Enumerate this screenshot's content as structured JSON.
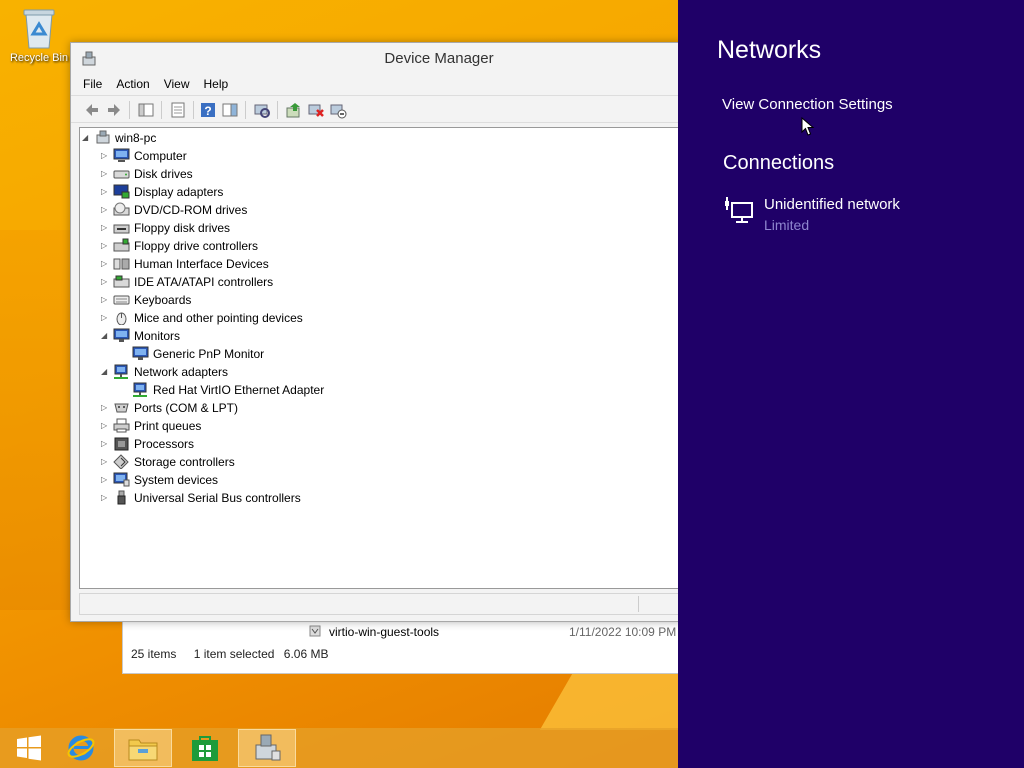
{
  "desktop": {
    "recycle_bin_label": "Recycle Bin"
  },
  "explorer": {
    "file_name": "virtio-win-guest-tools",
    "file_date": "1/11/2022 10:09 PM",
    "items_count": "25 items",
    "selected": "1 item selected",
    "size": "6.06 MB"
  },
  "device_manager": {
    "title": "Device Manager",
    "menu": [
      "File",
      "Action",
      "View",
      "Help"
    ],
    "root": "win8-pc",
    "tree": [
      {
        "label": "Computer",
        "level": 1,
        "expanded": false,
        "icon": "computer-icon"
      },
      {
        "label": "Disk drives",
        "level": 1,
        "expanded": false,
        "icon": "disk-drive-icon"
      },
      {
        "label": "Display adapters",
        "level": 1,
        "expanded": false,
        "icon": "display-adapter-icon"
      },
      {
        "label": "DVD/CD-ROM drives",
        "level": 1,
        "expanded": false,
        "icon": "dvd-drive-icon"
      },
      {
        "label": "Floppy disk drives",
        "level": 1,
        "expanded": false,
        "icon": "floppy-drive-icon"
      },
      {
        "label": "Floppy drive controllers",
        "level": 1,
        "expanded": false,
        "icon": "floppy-controller-icon"
      },
      {
        "label": "Human Interface Devices",
        "level": 1,
        "expanded": false,
        "icon": "hid-icon"
      },
      {
        "label": "IDE ATA/ATAPI controllers",
        "level": 1,
        "expanded": false,
        "icon": "ide-controller-icon"
      },
      {
        "label": "Keyboards",
        "level": 1,
        "expanded": false,
        "icon": "keyboard-icon"
      },
      {
        "label": "Mice and other pointing devices",
        "level": 1,
        "expanded": false,
        "icon": "mouse-icon"
      },
      {
        "label": "Monitors",
        "level": 1,
        "expanded": true,
        "icon": "monitor-icon"
      },
      {
        "label": "Generic PnP Monitor",
        "level": 2,
        "icon": "monitor-icon"
      },
      {
        "label": "Network adapters",
        "level": 1,
        "expanded": true,
        "icon": "network-adapter-icon"
      },
      {
        "label": "Red Hat VirtIO Ethernet Adapter",
        "level": 2,
        "icon": "network-adapter-icon"
      },
      {
        "label": "Ports (COM & LPT)",
        "level": 1,
        "expanded": false,
        "icon": "port-icon"
      },
      {
        "label": "Print queues",
        "level": 1,
        "expanded": false,
        "icon": "printer-icon"
      },
      {
        "label": "Processors",
        "level": 1,
        "expanded": false,
        "icon": "processor-icon"
      },
      {
        "label": "Storage controllers",
        "level": 1,
        "expanded": false,
        "icon": "storage-controller-icon"
      },
      {
        "label": "System devices",
        "level": 1,
        "expanded": false,
        "icon": "system-device-icon"
      },
      {
        "label": "Universal Serial Bus controllers",
        "level": 1,
        "expanded": false,
        "icon": "usb-icon"
      }
    ]
  },
  "networks": {
    "title": "Networks",
    "view_settings": "View Connection Settings",
    "connections_header": "Connections",
    "connection_name": "Unidentified network",
    "connection_status": "Limited",
    "background_color": "#1f0068"
  },
  "taskbar": {
    "items": [
      "start-icon",
      "internet-explorer-icon",
      "file-explorer-icon",
      "store-icon",
      "device-manager-icon"
    ]
  }
}
